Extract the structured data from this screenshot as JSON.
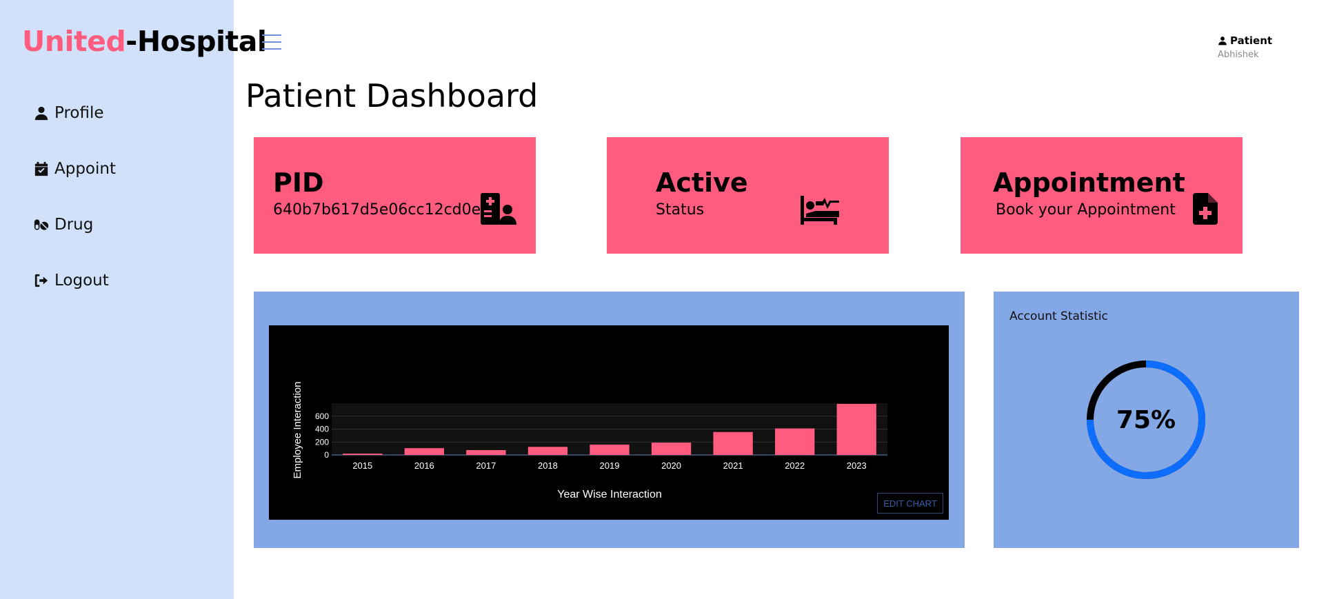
{
  "brand": {
    "part1": "United",
    "part2": "-Hospital"
  },
  "sidebar": {
    "items": [
      {
        "label": "Profile",
        "icon": "user-icon"
      },
      {
        "label": "Appoint",
        "icon": "calendar-check-icon"
      },
      {
        "label": "Drug",
        "icon": "pills-icon"
      },
      {
        "label": "Logout",
        "icon": "logout-icon"
      }
    ]
  },
  "user": {
    "role": "Patient",
    "name": "Abhishek"
  },
  "page": {
    "title": "Patient Dashboard"
  },
  "cards": [
    {
      "title": "PID",
      "subtitle": "640b7b617d5e06cc12cd0e15",
      "icon": "hospital-user-icon"
    },
    {
      "title": "Active",
      "subtitle": "Status",
      "icon": "bed-pulse-icon"
    },
    {
      "title": "Appointment",
      "subtitle": "Book your Appointment",
      "icon": "file-medical-icon"
    }
  ],
  "colors": {
    "accent": "#ff5c7f",
    "sidebar": "#d1e1f9",
    "panel": "#84a7e5",
    "ring": "#0d6efd"
  },
  "chart": {
    "edit_label": "EDIT CHART"
  },
  "chart_data": {
    "type": "bar",
    "categories": [
      "2015",
      "2016",
      "2017",
      "2018",
      "2019",
      "2020",
      "2021",
      "2022",
      "2023"
    ],
    "values": [
      20,
      105,
      75,
      125,
      160,
      190,
      355,
      410,
      790
    ],
    "xlabel": "Year Wise Interaction",
    "ylabel": "Employee Interaction",
    "yticks": [
      0,
      200,
      400,
      600
    ],
    "ylim": [
      0,
      800
    ],
    "bar_color": "#ff5c7f",
    "background": "#000000",
    "grid": true
  },
  "stat": {
    "title": "Account Statistic",
    "value": "75%",
    "fraction": 0.75
  }
}
